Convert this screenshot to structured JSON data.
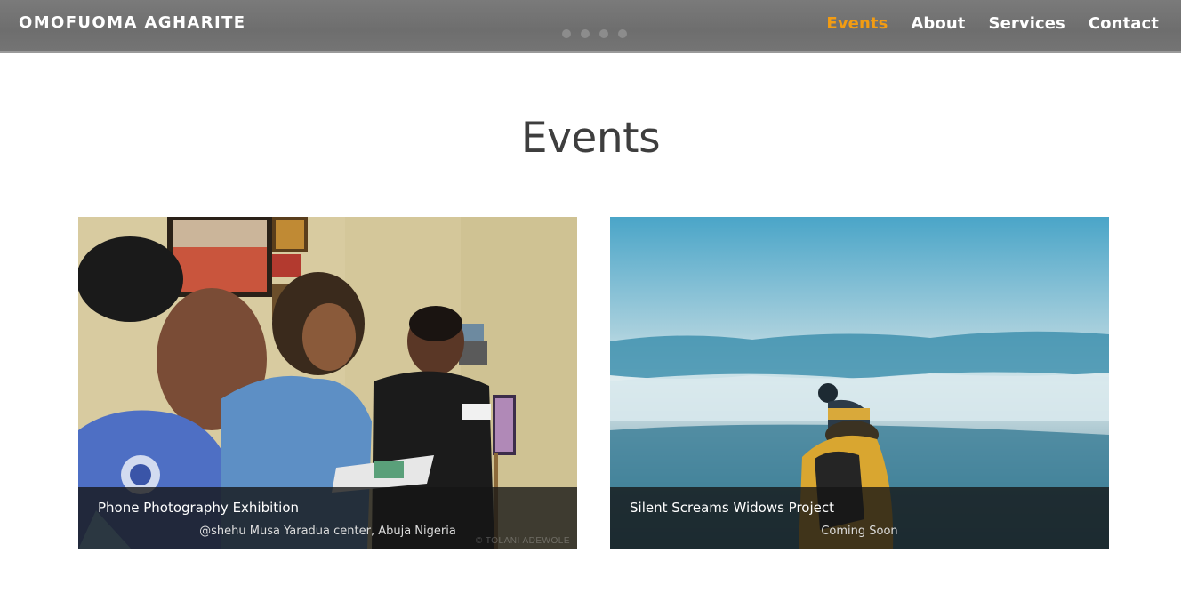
{
  "brand": "OMOFUOMA AGHARITE",
  "slider_dots": 4,
  "nav": [
    {
      "label": "Events",
      "active": true
    },
    {
      "label": "About",
      "active": false
    },
    {
      "label": "Services",
      "active": false
    },
    {
      "label": "Contact",
      "active": false
    }
  ],
  "page_title": "Events",
  "events": [
    {
      "title": "Phone Photography Exhibition",
      "subtitle": "@shehu Musa Yaradua center, Abuja Nigeria",
      "watermark": "© TOLANI ADEWOLE"
    },
    {
      "title": "Silent Screams Widows Project",
      "subtitle": "Coming Soon"
    }
  ],
  "colors": {
    "accent": "#f39c12",
    "navbar": "#737373",
    "title": "#3e3e3e"
  }
}
